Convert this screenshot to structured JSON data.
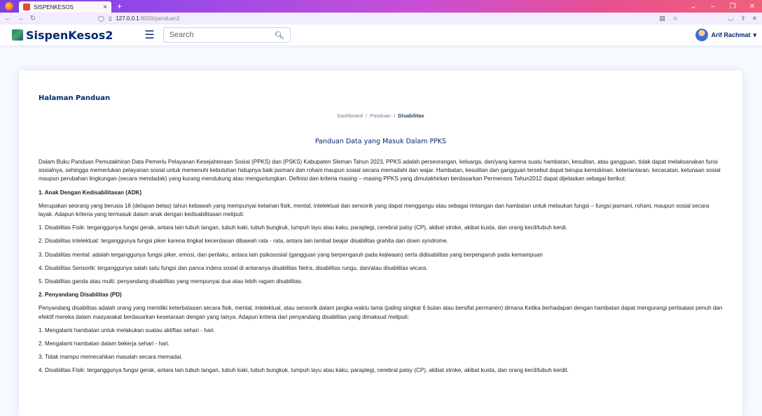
{
  "browser": {
    "tab_title": "SISPENKESOS",
    "url_host": "127.0.0.1",
    "url_path": ":8000/panduan2"
  },
  "header": {
    "brand": "SispenKesos2",
    "search_placeholder": "Search",
    "user_name": "Arif Rachmat"
  },
  "page": {
    "title": "Halaman Panduan",
    "breadcrumb": [
      "Dashboard",
      "Panduan",
      "Disabilitas"
    ],
    "guide_title": "Panduan Data yang Masuk Dalam PPKS"
  },
  "content": {
    "intro": "Dalam Buku Panduan Pemutakhiran Data Pemerlu Pelayanan Kesejahteraan Sosial (PPKS) dan (PSKS) Kabupaten Sleman Tahun 2023, PPKS adalah perseorangan, keluarga, dan/yang karena suatu hambatan, kesulitan, atau gangguan, tidak dapat melaksanakan funsi sosialnya, sehingga memerlukan pelayanan sosial untuk memenuhi kebutuhan hidupnya baik jasmani dan rohani maupun sosial secara memadahi dan wajar. Hambatan, kesulitan dan gangguan tersebut dapat berupa kemiskinan, keterlantaran, kecacatan, ketunaan sosial maupun perubahan lingkungan (secara mendadak) yang kurang mendukung atau menguntungkan. Definisi dan kriteria masing – masing PPKS yang dimutakhirkan berdasarkan Permensos Tahun2012 dapat dijelaskan sebagai berikut:",
    "section1": {
      "heading": "1. Anak Dengan Kedisabilitasan (ADK)",
      "desc": "Merupakan seorang yang berusia 18 (delapan belas) tahun kebawah yang mempunyai kelainan fisik, mental, intelektual dan sensorik yang dapat menggangu atau sebagai rintangan dan hambatan untuk melaukan fungsi – fungsi jasmani, rohani, maupun sosial secara layak. Adapun kriteria yang termasuk dalam anak dengan kedisabilitasan meliputi:",
      "items": [
        "1. Disabilitas Fisik: terganggunya fungsi gerak, antara lain tubuh tangan, tubuh kaki, tubuh bungkuk, lumpuh layu atau kaku, paraplegi, cerebral palsy (CP), akibat stroke, akibat kusta, dan orang kecil/tubuh kerdi.",
        "2. Disabilitas intelektual: terganggunya fungsi piker karena tingkat kecerdasan dibawah rata - rata, antara lain lambat beajar disabilitas grahita dan down syndrome.",
        "3. Disabilitas mental: adalah terganggunya fungsi piker, emosi, dan perilaku, antara lain psikososial (gangguan yang berpengaruh pada kejiwaan) serta didisabilitas yang berpengaruh pada kemampuan",
        "4. Disabilitas Sensorik: terganggunya salah satu fungsi dan panca indera sosial di antaranya disabilitas Netra, disabilitas rungu, dan/atau disabilitas wicara.",
        "5. Disabilitas ganda atau multi: penyandang disabilitas yang mempunyai dua atau lebih ragam disabilitas."
      ]
    },
    "section2": {
      "heading": "2. Penyandang Disabilitas (PD)",
      "desc": "Penyandang disabilitas adalah orang yang memiliki keterbatasan secara fisik, mental, intelektual, atau sensorik dalam jangka waktu lama (paling singkat 6 bulan atau bersifat permanen) dimana Ketika berhadapan dengan hambatan dapat mengurangi pertisaiasi penuh dan efektif mereka dalam masyarakat berdasarkan kesetaraan dengan yang lainya. Adapun kriteria dari penyandang disabilitas yang dimaksud meliputi:",
      "items": [
        "1. Mengalami hambatan untuk melakukan suatau aktiftas sehari - hari.",
        "2. Mengalami hambatan dalam bekerja sehari - hari.",
        "3. Tidak mampu memecahkan masalah secara memadai.",
        "4. Disabilitas Fisik: terganggunya fungsi gerak, antara lain tubuh tangan, tubuh kaki, tubuh bungkuk, lumpuh layu atau kaku, paraplegi, cerebral palsy (CP), akibat stroke, akibat kusta, dan orang kecil/tubuh kerdil."
      ]
    }
  },
  "colors": {
    "primary": "#012970",
    "page_bg": "#f6f9ff"
  }
}
